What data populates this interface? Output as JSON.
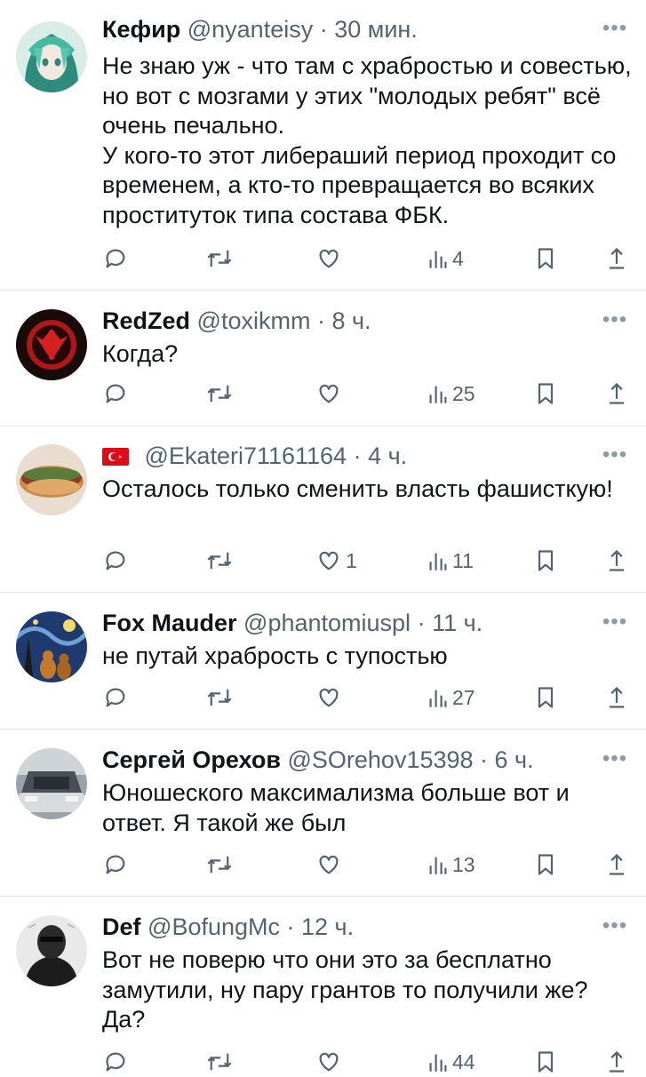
{
  "tweets": [
    {
      "name": "Кефир",
      "handle": "@nyanteisy",
      "time": "· 30 мин.",
      "text": "Не знаю уж - что там с храбростью и совестью, но вот с мозгами у этих \"молодых ребят\" всё очень печально.\nУ кого-то этот либераший период проходит со временем, а кто-то превращается во всяких проституток типа состава ФБК.",
      "replies": "",
      "reposts": "",
      "likes": "",
      "views": "4",
      "avatar": "anime-avatar"
    },
    {
      "name": "RedZed",
      "handle": "@toxikmm",
      "time": "· 8 ч.",
      "text": "Когда?",
      "replies": "",
      "reposts": "",
      "likes": "",
      "views": "25",
      "avatar": "horde-emblem-avatar"
    },
    {
      "name": "",
      "flag": "turkey-flag",
      "handle": "@Ekateri71161164",
      "time": "· 4 ч.",
      "text": "Осталось только сменить власть фашисткую!",
      "replies": "",
      "reposts": "",
      "likes": "1",
      "views": "11",
      "avatar": "sandwich-avatar"
    },
    {
      "name": "Fox Mauder",
      "handle": "@phantomiuspl",
      "time": "· 11 ч.",
      "text": "не путай храбрость с тупостью",
      "replies": "",
      "reposts": "",
      "likes": "",
      "views": "27",
      "avatar": "starry-night-cats-avatar"
    },
    {
      "name": "Сергей Орехов",
      "handle": "@SOrehov15398",
      "time": "· 6 ч.",
      "text": "Юношеского максимализма больше вот и ответ. Я такой же был",
      "replies": "",
      "reposts": "",
      "likes": "",
      "views": "13",
      "avatar": "car-engine-avatar"
    },
    {
      "name": "Def",
      "handle": "@BofungMc",
      "time": "· 12 ч.",
      "text": "Вот не поверю что они это за бесплатно замутили, ну пару грантов то получили же? Да?",
      "replies": "",
      "reposts": "",
      "likes": "",
      "views": "44",
      "avatar": "masked-person-avatar"
    }
  ],
  "icons": {
    "reply": "reply-icon",
    "repost": "repost-icon",
    "like": "like-icon",
    "views": "views-icon",
    "bookmark": "bookmark-icon",
    "share": "share-icon",
    "more": "more-icon"
  },
  "colors": {
    "text": "#0f1419",
    "secondary": "#536471",
    "divider": "#e3e6e9"
  }
}
